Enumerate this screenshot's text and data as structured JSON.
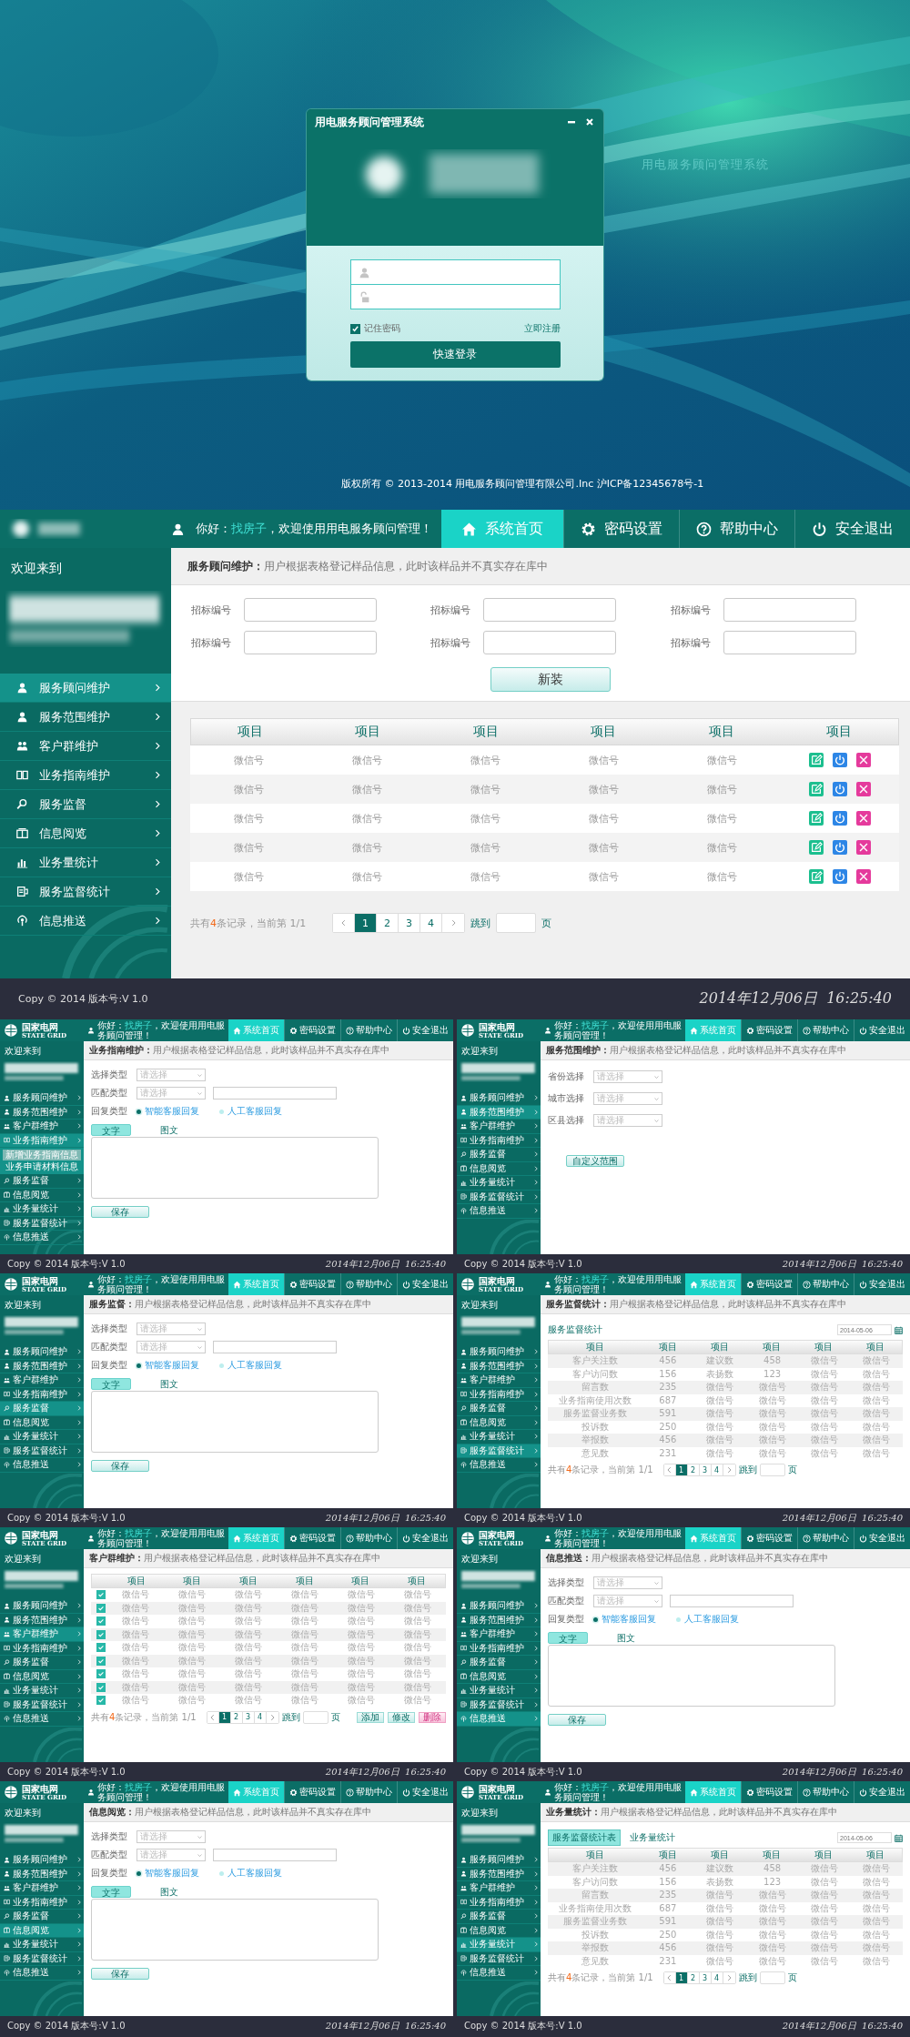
{
  "login": {
    "window_title": "用电服务顾问管理系统",
    "tagline": "用电服务顾问管理系统",
    "remember": {
      "label": "记住密码",
      "checked": true
    },
    "register_link": "立即注册",
    "submit": "快速登录",
    "copyright": "版权所有 © 2013-2014 用电服务顾问管理有限公司.Inc 沪ICP备12345678号-1"
  },
  "main": {
    "header": {
      "greeting": "你好：",
      "user": "找房子",
      "welcome": "，欢迎使用用电服务顾问管理！",
      "nav": [
        {
          "label": "系统首页",
          "selected": true
        },
        {
          "label": "密码设置",
          "selected": false
        },
        {
          "label": "帮助中心",
          "selected": false
        },
        {
          "label": "安全退出",
          "selected": false
        }
      ]
    },
    "sidebar": {
      "welcome": "欢迎来到",
      "items": [
        {
          "label": "服务顾问维护",
          "selected": true
        },
        {
          "label": "服务范围维护",
          "selected": false
        },
        {
          "label": "客户群维护",
          "selected": false
        },
        {
          "label": "业务指南维护",
          "selected": false
        },
        {
          "label": "服务监督",
          "selected": false
        },
        {
          "label": "信息阅览",
          "selected": false
        },
        {
          "label": "业务量统计",
          "selected": false
        },
        {
          "label": "服务监督统计",
          "selected": false
        },
        {
          "label": "信息推送",
          "selected": false
        }
      ]
    },
    "breadcrumb": {
      "title": "服务顾问维护：",
      "text": "用户根据表格登记样品信息，此时该样品并不真实存在库中"
    },
    "content": {
      "kind": "fields_table",
      "fields": [
        {
          "label": "招标编号"
        },
        {
          "label": "招标编号"
        },
        {
          "label": "招标编号"
        },
        {
          "label": "招标编号"
        },
        {
          "label": "招标编号"
        },
        {
          "label": "招标编号"
        }
      ],
      "submit": "新装",
      "columns": [
        "项目",
        "项目",
        "项目",
        "项目",
        "项目",
        "项目"
      ],
      "rows": [
        {
          "cells": [
            "微信号",
            "微信号",
            "微信号",
            "微信号",
            "微信号"
          ]
        },
        {
          "cells": [
            "微信号",
            "微信号",
            "微信号",
            "微信号",
            "微信号"
          ]
        },
        {
          "cells": [
            "微信号",
            "微信号",
            "微信号",
            "微信号",
            "微信号"
          ]
        },
        {
          "cells": [
            "微信号",
            "微信号",
            "微信号",
            "微信号",
            "微信号"
          ]
        },
        {
          "cells": [
            "微信号",
            "微信号",
            "微信号",
            "微信号",
            "微信号"
          ]
        }
      ],
      "pagination": {
        "summary_before": "共有",
        "summary_count": "4",
        "summary_after": "条记录，当前第 1/1",
        "pages": [
          {
            "label": "1",
            "selected": true
          },
          {
            "label": "2",
            "selected": false
          },
          {
            "label": "3",
            "selected": false
          },
          {
            "label": "4",
            "selected": false
          }
        ],
        "jump_label": "跳到",
        "page_unit": "页"
      }
    },
    "footer": {
      "copyright": "Copy © 2014 版本号:V 1.0",
      "datetime": "2014年12月06日  16:25:40"
    }
  },
  "thumbnails": [
    {
      "header": {
        "logo_text": "国家电网",
        "logo_subtext": "STATE GRID",
        "greeting": "你好：",
        "user": "找房子",
        "welcome": "，欢迎使用用电服务顾问管理！",
        "nav": [
          {
            "label": "系统首页",
            "selected": true
          },
          {
            "label": "密码设置",
            "selected": false
          },
          {
            "label": "帮助中心",
            "selected": false
          },
          {
            "label": "安全退出",
            "selected": false
          }
        ]
      },
      "sidebar": {
        "welcome": "欢迎来到",
        "items": [
          {
            "label": "服务顾问维护",
            "selected": false
          },
          {
            "label": "服务范围维护",
            "selected": false
          },
          {
            "label": "客户群维护",
            "selected": false
          },
          {
            "label": "业务指南维护",
            "selected": true,
            "children": [
              {
                "label": "新增业务指南信息",
                "selected": true
              },
              {
                "label": "业务申请材料信息",
                "selected": false
              }
            ]
          },
          {
            "label": "服务监督",
            "selected": false
          },
          {
            "label": "信息阅览",
            "selected": false
          },
          {
            "label": "业务量统计",
            "selected": false
          },
          {
            "label": "服务监督统计",
            "selected": false
          },
          {
            "label": "信息推送",
            "selected": false
          }
        ]
      },
      "breadcrumb": {
        "title": "业务指南维护：",
        "text": "用户根据表格登记样品信息，此时该样品并不真实存在库中"
      },
      "content": {
        "kind": "form",
        "type_label": "选择类型",
        "type_select": "请选择",
        "match_label": "匹配类型",
        "match_select": "请选择",
        "reply_label": "回复类型",
        "replies": [
          {
            "label": "智能客服回复",
            "selected": true
          },
          {
            "label": "人工客服回复",
            "selected": false
          }
        ],
        "tabs": [
          {
            "label": "文字",
            "selected": true
          },
          {
            "label": "图文",
            "selected": false
          }
        ],
        "save": "保存"
      },
      "footer": {
        "copyright": "Copy © 2014 版本号:V 1.0",
        "datetime": "2014年12月06日  16:25:40"
      }
    },
    {
      "header": {
        "logo_text": "国家电网",
        "logo_subtext": "STATE GRID",
        "greeting": "你好：",
        "user": "找房子",
        "welcome": "，欢迎使用用电服务顾问管理！",
        "nav": [
          {
            "label": "系统首页",
            "selected": true
          },
          {
            "label": "密码设置",
            "selected": false
          },
          {
            "label": "帮助中心",
            "selected": false
          },
          {
            "label": "安全退出",
            "selected": false
          }
        ]
      },
      "sidebar": {
        "welcome": "欢迎来到",
        "items": [
          {
            "label": "服务顾问维护",
            "selected": false
          },
          {
            "label": "服务范围维护",
            "selected": true
          },
          {
            "label": "客户群维护",
            "selected": false
          },
          {
            "label": "业务指南维护",
            "selected": false
          },
          {
            "label": "服务监督",
            "selected": false
          },
          {
            "label": "信息阅览",
            "selected": false
          },
          {
            "label": "业务量统计",
            "selected": false
          },
          {
            "label": "服务监督统计",
            "selected": false
          },
          {
            "label": "信息推送",
            "selected": false
          }
        ]
      },
      "breadcrumb": {
        "title": "服务范围维护：",
        "text": "用户根据表格登记样品信息，此时该样品并不真实存在库中"
      },
      "content": {
        "kind": "selects",
        "rows": [
          {
            "label": "省份选择",
            "select": "请选择"
          },
          {
            "label": "城市选择",
            "select": "请选择"
          },
          {
            "label": "区县选择",
            "select": "请选择"
          }
        ],
        "button": "自定义范围"
      },
      "footer": {
        "copyright": "Copy © 2014 版本号:V 1.0",
        "datetime": "2014年12月06日  16:25:40"
      }
    },
    {
      "header": {
        "logo_text": "国家电网",
        "logo_subtext": "STATE GRID",
        "greeting": "你好：",
        "user": "找房子",
        "welcome": "，欢迎使用用电服务顾问管理！",
        "nav": [
          {
            "label": "系统首页",
            "selected": true
          },
          {
            "label": "密码设置",
            "selected": false
          },
          {
            "label": "帮助中心",
            "selected": false
          },
          {
            "label": "安全退出",
            "selected": false
          }
        ]
      },
      "sidebar": {
        "welcome": "欢迎来到",
        "items": [
          {
            "label": "服务顾问维护",
            "selected": false
          },
          {
            "label": "服务范围维护",
            "selected": false
          },
          {
            "label": "客户群维护",
            "selected": false
          },
          {
            "label": "业务指南维护",
            "selected": false
          },
          {
            "label": "服务监督",
            "selected": true
          },
          {
            "label": "信息阅览",
            "selected": false
          },
          {
            "label": "业务量统计",
            "selected": false
          },
          {
            "label": "服务监督统计",
            "selected": false
          },
          {
            "label": "信息推送",
            "selected": false
          }
        ]
      },
      "breadcrumb": {
        "title": "服务监督：",
        "text": "用户根据表格登记样品信息，此时该样品并不真实存在库中"
      },
      "content": {
        "kind": "form",
        "type_label": "选择类型",
        "type_select": "请选择",
        "match_label": "匹配类型",
        "match_select": "请选择",
        "reply_label": "回复类型",
        "replies": [
          {
            "label": "智能客服回复",
            "selected": true
          },
          {
            "label": "人工客服回复",
            "selected": false
          }
        ],
        "tabs": [
          {
            "label": "文字",
            "selected": true
          },
          {
            "label": "图文",
            "selected": false
          }
        ],
        "save": "保存"
      },
      "footer": {
        "copyright": "Copy © 2014 版本号:V 1.0",
        "datetime": "2014年12月06日  16:25:40"
      }
    },
    {
      "header": {
        "logo_text": "国家电网",
        "logo_subtext": "STATE GRID",
        "greeting": "你好：",
        "user": "找房子",
        "welcome": "，欢迎使用用电服务顾问管理！",
        "nav": [
          {
            "label": "系统首页",
            "selected": true
          },
          {
            "label": "密码设置",
            "selected": false
          },
          {
            "label": "帮助中心",
            "selected": false
          },
          {
            "label": "安全退出",
            "selected": false
          }
        ]
      },
      "sidebar": {
        "welcome": "欢迎来到",
        "items": [
          {
            "label": "服务顾问维护",
            "selected": false
          },
          {
            "label": "服务范围维护",
            "selected": false
          },
          {
            "label": "客户群维护",
            "selected": false
          },
          {
            "label": "业务指南维护",
            "selected": false
          },
          {
            "label": "服务监督",
            "selected": false
          },
          {
            "label": "信息阅览",
            "selected": false
          },
          {
            "label": "业务量统计",
            "selected": false
          },
          {
            "label": "服务监督统计",
            "selected": true
          },
          {
            "label": "信息推送",
            "selected": false
          }
        ]
      },
      "breadcrumb": {
        "title": "服务监督统计：",
        "text": "用户根据表格登记样品信息，此时该样品并不真实存在库中"
      },
      "content": {
        "kind": "stats",
        "heading": "服务监督统计",
        "date_placeholder": "2014-05-06",
        "columns": [
          "项目",
          "项目",
          "项目",
          "项目",
          "项目",
          "项目"
        ],
        "rows": [
          {
            "cells": [
              "客户关注数",
              "456",
              "建议数",
              "458",
              "微信号",
              "微信号"
            ]
          },
          {
            "cells": [
              "客户访问数",
              "156",
              "表扬数",
              "123",
              "微信号",
              "微信号"
            ]
          },
          {
            "cells": [
              "留言数",
              "235",
              "微信号",
              "微信号",
              "微信号",
              "微信号"
            ]
          },
          {
            "cells": [
              "业务指南使用次数",
              "687",
              "微信号",
              "微信号",
              "微信号",
              "微信号"
            ]
          },
          {
            "cells": [
              "服务监督业务数",
              "591",
              "微信号",
              "微信号",
              "微信号",
              "微信号"
            ]
          },
          {
            "cells": [
              "投诉数",
              "250",
              "微信号",
              "微信号",
              "微信号",
              "微信号"
            ]
          },
          {
            "cells": [
              "举报数",
              "456",
              "微信号",
              "微信号",
              "微信号",
              "微信号"
            ]
          },
          {
            "cells": [
              "意见数",
              "231",
              "微信号",
              "微信号",
              "微信号",
              "微信号"
            ]
          }
        ],
        "pagination": {
          "summary_before": "共有",
          "summary_count": "4",
          "summary_after": "条记录，当前第 1/1",
          "pages": [
            {
              "label": "1",
              "selected": true
            },
            {
              "label": "2",
              "selected": false
            },
            {
              "label": "3",
              "selected": false
            },
            {
              "label": "4",
              "selected": false
            }
          ],
          "jump_label": "跳到",
          "page_unit": "页"
        }
      },
      "footer": {
        "copyright": "Copy © 2014 版本号:V 1.0",
        "datetime": "2014年12月06日  16:25:40"
      }
    },
    {
      "header": {
        "logo_text": "国家电网",
        "logo_subtext": "STATE GRID",
        "greeting": "你好：",
        "user": "找房子",
        "welcome": "，欢迎使用用电服务顾问管理！",
        "nav": [
          {
            "label": "系统首页",
            "selected": true
          },
          {
            "label": "密码设置",
            "selected": false
          },
          {
            "label": "帮助中心",
            "selected": false
          },
          {
            "label": "安全退出",
            "selected": false
          }
        ]
      },
      "sidebar": {
        "welcome": "欢迎来到",
        "items": [
          {
            "label": "服务顾问维护",
            "selected": false
          },
          {
            "label": "服务范围维护",
            "selected": false
          },
          {
            "label": "客户群维护",
            "selected": true
          },
          {
            "label": "业务指南维护",
            "selected": false
          },
          {
            "label": "服务监督",
            "selected": false
          },
          {
            "label": "信息阅览",
            "selected": false
          },
          {
            "label": "业务量统计",
            "selected": false
          },
          {
            "label": "服务监督统计",
            "selected": false
          },
          {
            "label": "信息推送",
            "selected": false
          }
        ]
      },
      "breadcrumb": {
        "title": "客户群维护：",
        "text": "用户根据表格登记样品信息，此时该样品并不真实存在库中"
      },
      "content": {
        "kind": "checks",
        "columns": [
          "项目",
          "项目",
          "项目",
          "项目",
          "项目",
          "项目"
        ],
        "rows": [
          {
            "checked": true,
            "cells": [
              "微信号",
              "微信号",
              "微信号",
              "微信号",
              "微信号",
              "微信号"
            ]
          },
          {
            "checked": true,
            "cells": [
              "微信号",
              "微信号",
              "微信号",
              "微信号",
              "微信号",
              "微信号"
            ]
          },
          {
            "checked": true,
            "cells": [
              "微信号",
              "微信号",
              "微信号",
              "微信号",
              "微信号",
              "微信号"
            ]
          },
          {
            "checked": true,
            "cells": [
              "微信号",
              "微信号",
              "微信号",
              "微信号",
              "微信号",
              "微信号"
            ]
          },
          {
            "checked": true,
            "cells": [
              "微信号",
              "微信号",
              "微信号",
              "微信号",
              "微信号",
              "微信号"
            ]
          },
          {
            "checked": true,
            "cells": [
              "微信号",
              "微信号",
              "微信号",
              "微信号",
              "微信号",
              "微信号"
            ]
          },
          {
            "checked": true,
            "cells": [
              "微信号",
              "微信号",
              "微信号",
              "微信号",
              "微信号",
              "微信号"
            ]
          },
          {
            "checked": true,
            "cells": [
              "微信号",
              "微信号",
              "微信号",
              "微信号",
              "微信号",
              "微信号"
            ]
          },
          {
            "checked": true,
            "cells": [
              "微信号",
              "微信号",
              "微信号",
              "微信号",
              "微信号",
              "微信号"
            ]
          }
        ],
        "pagination": {
          "summary_before": "共有",
          "summary_count": "4",
          "summary_after": "条记录，当前第 1/1",
          "pages": [
            {
              "label": "1",
              "selected": true
            },
            {
              "label": "2",
              "selected": false
            },
            {
              "label": "3",
              "selected": false
            },
            {
              "label": "4",
              "selected": false
            }
          ],
          "jump_label": "跳到",
          "page_unit": "页"
        },
        "buttons": [
          {
            "label": "添加",
            "kind": "normal"
          },
          {
            "label": "修改",
            "kind": "normal"
          },
          {
            "label": "删除",
            "kind": "danger"
          }
        ]
      },
      "footer": {
        "copyright": "Copy © 2014 版本号:V 1.0",
        "datetime": "2014年12月06日  16:25:40"
      }
    },
    {
      "header": {
        "logo_text": "国家电网",
        "logo_subtext": "STATE GRID",
        "greeting": "你好：",
        "user": "找房子",
        "welcome": "，欢迎使用用电服务顾问管理！",
        "nav": [
          {
            "label": "系统首页",
            "selected": true
          },
          {
            "label": "密码设置",
            "selected": false
          },
          {
            "label": "帮助中心",
            "selected": false
          },
          {
            "label": "安全退出",
            "selected": false
          }
        ]
      },
      "sidebar": {
        "welcome": "欢迎来到",
        "items": [
          {
            "label": "服务顾问维护",
            "selected": false
          },
          {
            "label": "服务范围维护",
            "selected": false
          },
          {
            "label": "客户群维护",
            "selected": false
          },
          {
            "label": "业务指南维护",
            "selected": false
          },
          {
            "label": "服务监督",
            "selected": false
          },
          {
            "label": "信息阅览",
            "selected": false
          },
          {
            "label": "业务量统计",
            "selected": false
          },
          {
            "label": "服务监督统计",
            "selected": false
          },
          {
            "label": "信息推送",
            "selected": true
          }
        ]
      },
      "breadcrumb": {
        "title": "信息推送：",
        "text": "用户根据表格登记样品信息，此时该样品并不真实存在库中"
      },
      "content": {
        "kind": "form",
        "type_label": "选择类型",
        "type_select": "请选择",
        "match_label": "匹配类型",
        "match_select": "请选择",
        "reply_label": "回复类型",
        "replies": [
          {
            "label": "智能客服回复",
            "selected": true
          },
          {
            "label": "人工客服回复",
            "selected": false
          }
        ],
        "tabs": [
          {
            "label": "文字",
            "selected": true
          },
          {
            "label": "图文",
            "selected": false
          }
        ],
        "save": "保存"
      },
      "footer": {
        "copyright": "Copy © 2014 版本号:V 1.0",
        "datetime": "2014年12月06日  16:25:40"
      }
    },
    {
      "header": {
        "logo_text": "国家电网",
        "logo_subtext": "STATE GRID",
        "greeting": "你好：",
        "user": "找房子",
        "welcome": "，欢迎使用用电服务顾问管理！",
        "nav": [
          {
            "label": "系统首页",
            "selected": true
          },
          {
            "label": "密码设置",
            "selected": false
          },
          {
            "label": "帮助中心",
            "selected": false
          },
          {
            "label": "安全退出",
            "selected": false
          }
        ]
      },
      "sidebar": {
        "welcome": "欢迎来到",
        "items": [
          {
            "label": "服务顾问维护",
            "selected": false
          },
          {
            "label": "服务范围维护",
            "selected": false
          },
          {
            "label": "客户群维护",
            "selected": false
          },
          {
            "label": "业务指南维护",
            "selected": false
          },
          {
            "label": "服务监督",
            "selected": false
          },
          {
            "label": "信息阅览",
            "selected": true
          },
          {
            "label": "业务量统计",
            "selected": false
          },
          {
            "label": "服务监督统计",
            "selected": false
          },
          {
            "label": "信息推送",
            "selected": false
          }
        ]
      },
      "breadcrumb": {
        "title": "信息阅览：",
        "text": "用户根据表格登记样品信息，此时该样品并不真实存在库中"
      },
      "content": {
        "kind": "form",
        "type_label": "选择类型",
        "type_select": "请选择",
        "match_label": "匹配类型",
        "match_select": "请选择",
        "reply_label": "回复类型",
        "replies": [
          {
            "label": "智能客服回复",
            "selected": true
          },
          {
            "label": "人工客服回复",
            "selected": false
          }
        ],
        "tabs": [
          {
            "label": "文字",
            "selected": true
          },
          {
            "label": "图文",
            "selected": false
          }
        ],
        "save": "保存"
      },
      "footer": {
        "copyright": "Copy © 2014 版本号:V 1.0",
        "datetime": "2014年12月06日  16:25:40"
      }
    },
    {
      "header": {
        "logo_text": "国家电网",
        "logo_subtext": "STATE GRID",
        "greeting": "你好：",
        "user": "找房子",
        "welcome": "，欢迎使用用电服务顾问管理！",
        "nav": [
          {
            "label": "系统首页",
            "selected": true
          },
          {
            "label": "密码设置",
            "selected": false
          },
          {
            "label": "帮助中心",
            "selected": false
          },
          {
            "label": "安全退出",
            "selected": false
          }
        ]
      },
      "sidebar": {
        "welcome": "欢迎来到",
        "items": [
          {
            "label": "服务顾问维护",
            "selected": false
          },
          {
            "label": "服务范围维护",
            "selected": false
          },
          {
            "label": "客户群维护",
            "selected": false
          },
          {
            "label": "业务指南维护",
            "selected": false
          },
          {
            "label": "服务监督",
            "selected": false
          },
          {
            "label": "信息阅览",
            "selected": false
          },
          {
            "label": "业务量统计",
            "selected": true
          },
          {
            "label": "服务监督统计",
            "selected": false
          },
          {
            "label": "信息推送",
            "selected": false
          }
        ]
      },
      "breadcrumb": {
        "title": "业务量统计：",
        "text": "用户根据表格登记样品信息，此时该样品并不真实存在库中"
      },
      "content": {
        "kind": "stats",
        "tabs": [
          {
            "label": "服务监督统计表",
            "selected": true
          },
          {
            "label": "业务量统计",
            "selected": false
          }
        ],
        "date_placeholder": "2014-05-06",
        "columns": [
          "项目",
          "项目",
          "项目",
          "项目",
          "项目",
          "项目"
        ],
        "rows": [
          {
            "cells": [
              "客户关注数",
              "456",
              "建议数",
              "458",
              "微信号",
              "微信号"
            ]
          },
          {
            "cells": [
              "客户访问数",
              "156",
              "表扬数",
              "123",
              "微信号",
              "微信号"
            ]
          },
          {
            "cells": [
              "留言数",
              "235",
              "微信号",
              "微信号",
              "微信号",
              "微信号"
            ]
          },
          {
            "cells": [
              "业务指南使用次数",
              "687",
              "微信号",
              "微信号",
              "微信号",
              "微信号"
            ]
          },
          {
            "cells": [
              "服务监督业务数",
              "591",
              "微信号",
              "微信号",
              "微信号",
              "微信号"
            ]
          },
          {
            "cells": [
              "投诉数",
              "250",
              "微信号",
              "微信号",
              "微信号",
              "微信号"
            ]
          },
          {
            "cells": [
              "举报数",
              "456",
              "微信号",
              "微信号",
              "微信号",
              "微信号"
            ]
          },
          {
            "cells": [
              "意见数",
              "231",
              "微信号",
              "微信号",
              "微信号",
              "微信号"
            ]
          }
        ],
        "pagination": {
          "summary_before": "共有",
          "summary_count": "4",
          "summary_after": "条记录，当前第 1/1",
          "pages": [
            {
              "label": "1",
              "selected": true
            },
            {
              "label": "2",
              "selected": false
            },
            {
              "label": "3",
              "selected": false
            },
            {
              "label": "4",
              "selected": false
            }
          ],
          "jump_label": "跳到",
          "page_unit": "页"
        }
      },
      "footer": {
        "copyright": "Copy © 2014 版本号:V 1.0",
        "datetime": "2014年12月06日  16:25:40"
      }
    }
  ]
}
